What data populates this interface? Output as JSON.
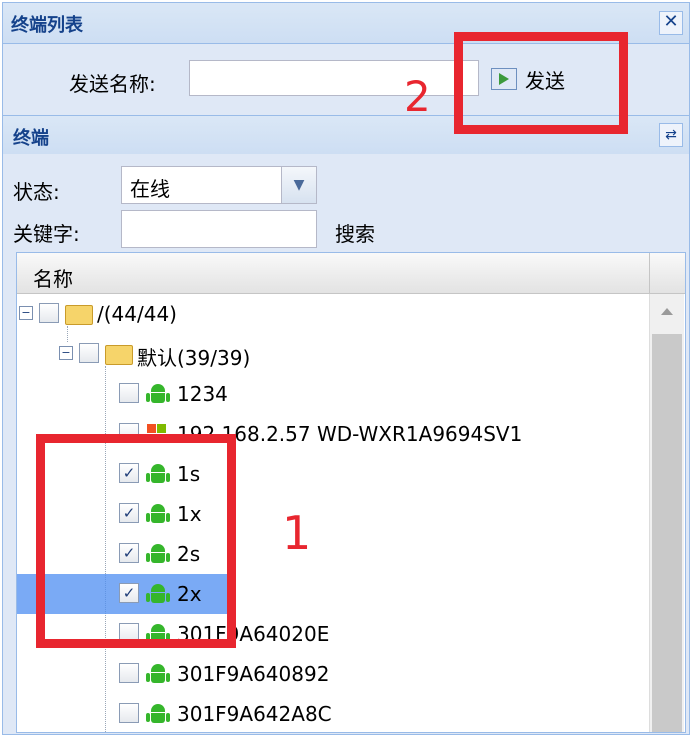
{
  "window": {
    "title": "终端列表",
    "close_glyph": "✕"
  },
  "send": {
    "label": "发送名称:",
    "value": "",
    "button_label": "发送"
  },
  "terminal_panel": {
    "title": "终端",
    "refresh_glyph": "⇄"
  },
  "filters": {
    "status_label": "状态:",
    "status_value": "在线",
    "keyword_label": "关键字:",
    "keyword_value": "",
    "search_label": "搜索"
  },
  "grid": {
    "column_name": "名称",
    "root": {
      "label": "/(44/44)"
    },
    "group": {
      "label": "默认(39/39)"
    },
    "items": [
      {
        "label": "1234",
        "checked": false,
        "icon": "android-icon"
      },
      {
        "label": "192.168.2.57 WD-WXR1A9694SV1",
        "checked": false,
        "icon": "windows-icon"
      },
      {
        "label": "1s",
        "checked": true,
        "icon": "android-icon"
      },
      {
        "label": "1x",
        "checked": true,
        "icon": "android-icon"
      },
      {
        "label": "2s",
        "checked": true,
        "icon": "android-icon"
      },
      {
        "label": "2x",
        "checked": true,
        "icon": "android-icon",
        "selected": true
      },
      {
        "label": "301F9A64020E",
        "checked": false,
        "icon": "android-icon"
      },
      {
        "label": "301F9A640892",
        "checked": false,
        "icon": "android-icon"
      },
      {
        "label": "301F9A642A8C",
        "checked": false,
        "icon": "android-icon"
      }
    ]
  },
  "annotations": {
    "first": "1",
    "second": "2",
    "color": "#e8262f"
  }
}
